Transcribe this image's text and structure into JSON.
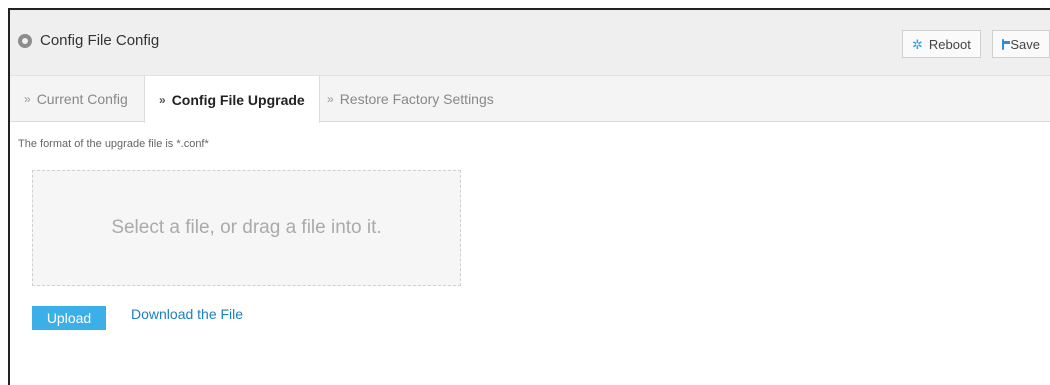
{
  "header": {
    "title": "Config File Config",
    "title_icon": "location-pin-icon",
    "reboot_label": "Reboot",
    "reboot_icon": "spinner-icon",
    "save_label": "Save",
    "save_icon": "floppy-disk-icon"
  },
  "tabs": [
    {
      "label": "Current Config",
      "active": false
    },
    {
      "label": "Config File Upgrade",
      "active": true
    },
    {
      "label": "Restore Factory Settings",
      "active": false
    }
  ],
  "upgrade": {
    "hint": "The format of the upgrade file is *.conf*",
    "dropzone_text": "Select a file, or drag a file into it.",
    "upload_label": "Upload",
    "download_label": "Download the File"
  },
  "colors": {
    "accent": "#3bb0e8",
    "link": "#1a7fc6"
  }
}
